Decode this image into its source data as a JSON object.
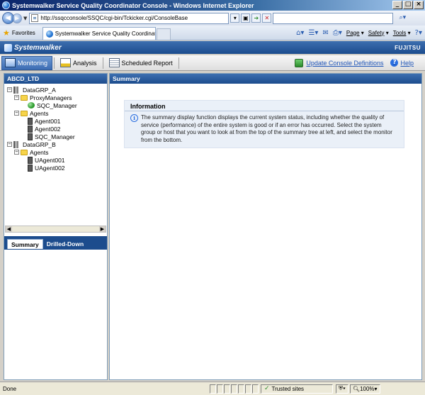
{
  "window": {
    "title": "Systemwalker Service Quality Coordinator Console - Windows Internet Explorer",
    "buttons": [
      "_",
      "□",
      "×"
    ]
  },
  "address": {
    "url": "http://ssqcconsole/SSQC/cgi-bin/Tckicker.cgi/ConsoleBase",
    "search_value": ""
  },
  "favorites": {
    "label": "Favorites",
    "tab_label": "Systemwalker Service Quality Coordinator ...",
    "commands": {
      "page": "Page",
      "safety": "Safety",
      "tools": "Tools"
    }
  },
  "app": {
    "brand": "Systemwalker",
    "vendor": "FUJITSU",
    "tabs": [
      {
        "label": "Monitoring",
        "active": true
      },
      {
        "label": "Analysis",
        "active": false
      },
      {
        "label": "Scheduled Report",
        "active": false
      }
    ],
    "update_link": "Update Console Definitions",
    "help_link": "Help"
  },
  "left": {
    "header": "ABCD_LTD",
    "tree": [
      {
        "label": "DataGRP_A",
        "icon": "server-group-icon",
        "exp": "⊟",
        "level": 0
      },
      {
        "label": "ProxyManagers",
        "icon": "folder-icon",
        "exp": "⊟",
        "level": 1
      },
      {
        "label": "SQC_Manager",
        "icon": "proxy-manager-icon",
        "exp": "",
        "level": 2
      },
      {
        "label": "Agents",
        "icon": "folder-icon",
        "exp": "⊟",
        "level": 1
      },
      {
        "label": "Agent001",
        "icon": "agent-icon",
        "exp": "",
        "level": 2
      },
      {
        "label": "Agent002",
        "icon": "agent-icon",
        "exp": "",
        "level": 2
      },
      {
        "label": "SQC_Manager",
        "icon": "agent-icon",
        "exp": "",
        "level": 2
      },
      {
        "label": "DataGRP_B",
        "icon": "server-group-icon",
        "exp": "⊟",
        "level": 0
      },
      {
        "label": "Agents",
        "icon": "folder-icon",
        "exp": "⊟",
        "level": 1
      },
      {
        "label": "UAgent001",
        "icon": "agent-icon",
        "exp": "",
        "level": 2
      },
      {
        "label": "UAgent002",
        "icon": "agent-icon",
        "exp": "",
        "level": 2
      }
    ],
    "subtabs": [
      {
        "label": "Summary",
        "active": true
      },
      {
        "label": "Drilled-Down",
        "active": false
      }
    ]
  },
  "right": {
    "header": "Summary",
    "info_title": "Information",
    "info_text": "The summary display function displays the current system status, including whether the quality of service (performance) of the entire system is good or if an error has occurred. Select the system group or host that you want to look at from the top of the summary tree at left, and select the monitor from the bottom."
  },
  "status": {
    "text": "Done",
    "zone": "Trusted sites",
    "zoom": "100%"
  }
}
